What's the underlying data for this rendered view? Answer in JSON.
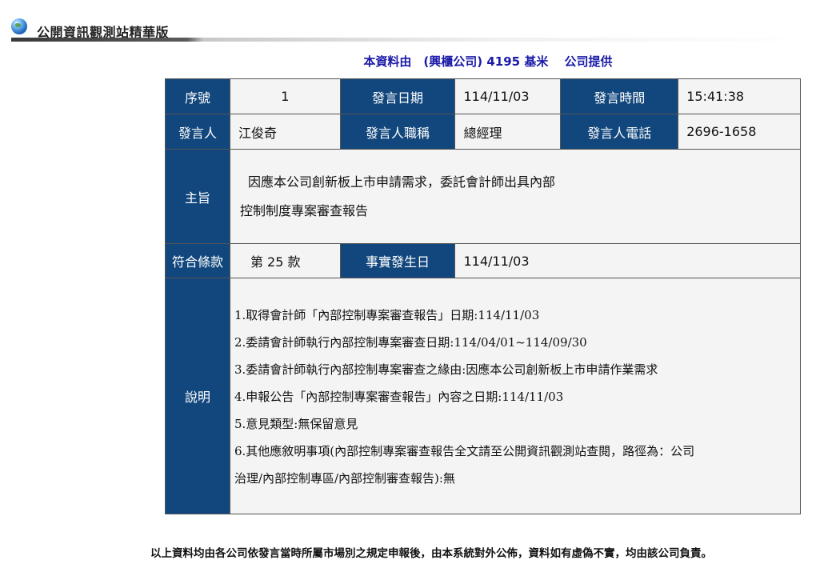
{
  "header": {
    "brand": "公開資訊觀測站精華版",
    "globe_icon": "globe-icon"
  },
  "provider": "本資料由　(興櫃公司) 4195 基米　 公司提供",
  "table": {
    "seq_label": "序號",
    "seq_value": "1",
    "date_label": "發言日期",
    "date_value": "114/11/03",
    "time_label": "發言時間",
    "time_value": "15:41:38",
    "speaker_label": "發言人",
    "speaker_value": "江俊奇",
    "title_label": "發言人職稱",
    "title_value": "總經理",
    "phone_label": "發言人電話",
    "phone_value": "2696-1658",
    "subject_label": "主旨",
    "subject_lines": [
      "因應本公司創新板上市申請需求，委託會計師出具內部",
      "控制制度專案審查報告"
    ],
    "clause_label": "符合條款",
    "clause_value": "第 25 款",
    "event_date_label": "事實發生日",
    "event_date_value": "114/11/03",
    "desc_label": "說明",
    "desc_lines": [
      "1.取得會計師「內部控制專案審查報告」日期:114/11/03",
      "2.委請會計師執行內部控制專案審查日期:114/04/01~114/09/30",
      "3.委請會計師執行內部控制專案審查之緣由:因應本公司創新板上市申請作業需求",
      "4.申報公告「內部控制專案審查報告」內容之日期:114/11/03",
      "5.意見類型:無保留意見",
      "6.其他應敘明事項(內部控制專案審查報告全文請至公開資訊觀測站查閱，路徑為：公司",
      "治理/內部控制專區/內部控制審查報告):無"
    ]
  },
  "footer": "以上資料均由各公司依發言當時所屬市場別之規定申報後，由本系統對外公佈，資料如有虛偽不實，均由該公司負責。",
  "colors": {
    "label_bg": "#12477d",
    "value_bg": "#f4f4f4",
    "provider_text": "#1a1aa8"
  }
}
